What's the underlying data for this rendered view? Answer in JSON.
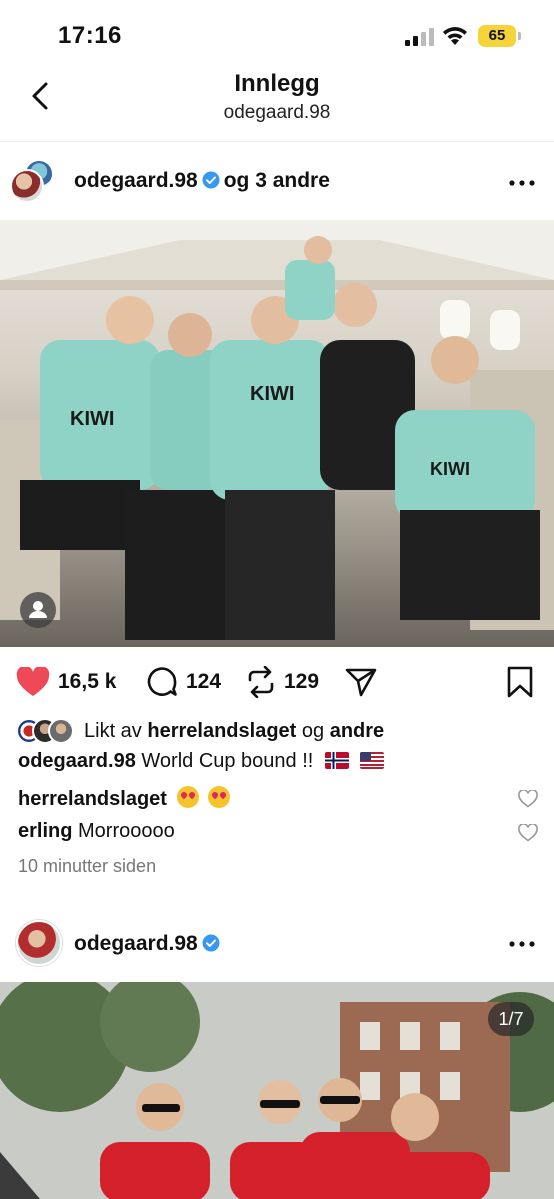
{
  "status_bar": {
    "time": "17:16",
    "battery": "65",
    "battery_color": "#f5d33b"
  },
  "header": {
    "title": "Innlegg",
    "subtitle": "odegaard.98",
    "back_icon": "chevron-left-icon"
  },
  "post": {
    "username": "odegaard.98",
    "coauthors": "og 3 andre",
    "verified_color": "#3897f0",
    "more_icon": "more-horizontal-icon",
    "image_icon": "tagged-user-icon",
    "actions": {
      "likes": "16,5 k",
      "comments": "124",
      "reposts": "129",
      "like_color": "#ed4956"
    },
    "liked_by_prefix": "Likt av",
    "liked_by_user": "herrelandslaget",
    "liked_by_conj": "og",
    "liked_by_rest": "andre",
    "caption_user": "odegaard.98",
    "caption_text": "World Cup bound !!",
    "comments_list": [
      {
        "user": "herrelandslaget",
        "text": ""
      },
      {
        "user": "erling",
        "text": "Morrooooo"
      }
    ],
    "timestamp": "10 minutter siden"
  },
  "post2": {
    "username": "odegaard.98",
    "carousel_counter": "1/7"
  }
}
